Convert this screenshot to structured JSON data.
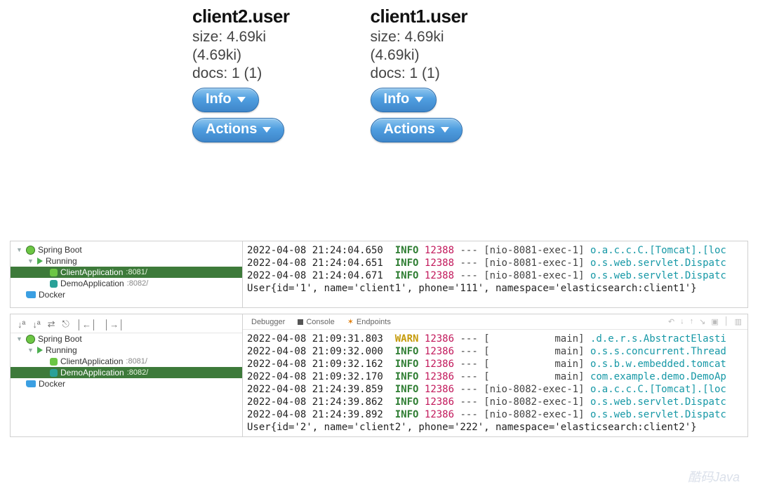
{
  "cards": [
    {
      "title": "client2.user",
      "size": "size: 4.69ki",
      "paren": "(4.69ki)",
      "docs": "docs: 1 (1)",
      "info": "Info",
      "actions": "Actions"
    },
    {
      "title": "client1.user",
      "size": "size: 4.69ki",
      "paren": "(4.69ki)",
      "docs": "docs: 1 (1)",
      "info": "Info",
      "actions": "Actions"
    }
  ],
  "tree1": {
    "springBoot": "Spring Boot",
    "running": "Running",
    "clientApp": "ClientApplication",
    "clientPort": ":8081/",
    "demoApp": "DemoApplication",
    "demoPort": ":8082/",
    "docker": "Docker"
  },
  "tree2": {
    "springBoot": "Spring Boot",
    "running": "Running",
    "clientApp": "ClientApplication",
    "clientPort": ":8081/",
    "demoApp": "DemoApplication",
    "demoPort": ":8082/",
    "docker": "Docker"
  },
  "toolbar2": {
    "t1": "↓ª",
    "t2": "↓ª",
    "t3": "⇄",
    "t4": "⎋",
    "t5": "│←│",
    "t6": "│→│"
  },
  "tabs": {
    "debugger": "Debugger",
    "console": "Console",
    "endpoints": "Endpoints"
  },
  "logs1": [
    {
      "ts": "2022-04-08 21:24:04.650",
      "lvl": "INFO",
      "pid": "12388",
      "thr": "[nio-8081-exec-1]",
      "cls": "o.a.c.c.C.[Tomcat].[loc"
    },
    {
      "ts": "2022-04-08 21:24:04.651",
      "lvl": "INFO",
      "pid": "12388",
      "thr": "[nio-8081-exec-1]",
      "cls": "o.s.web.servlet.Dispatc"
    },
    {
      "ts": "2022-04-08 21:24:04.671",
      "lvl": "INFO",
      "pid": "12388",
      "thr": "[nio-8081-exec-1]",
      "cls": "o.s.web.servlet.Dispatc"
    }
  ],
  "out1": "User{id='1', name='client1', phone='111', namespace='elasticsearch:client1'}",
  "logs2": [
    {
      "ts": "2022-04-08 21:09:31.803",
      "lvl": "WARN",
      "pid": "12386",
      "thr": "[           main]",
      "cls": ".d.e.r.s.AbstractElasti"
    },
    {
      "ts": "2022-04-08 21:09:32.000",
      "lvl": "INFO",
      "pid": "12386",
      "thr": "[           main]",
      "cls": "o.s.s.concurrent.Thread"
    },
    {
      "ts": "2022-04-08 21:09:32.162",
      "lvl": "INFO",
      "pid": "12386",
      "thr": "[           main]",
      "cls": "o.s.b.w.embedded.tomcat"
    },
    {
      "ts": "2022-04-08 21:09:32.170",
      "lvl": "INFO",
      "pid": "12386",
      "thr": "[           main]",
      "cls": "com.example.demo.DemoAp"
    },
    {
      "ts": "2022-04-08 21:24:39.859",
      "lvl": "INFO",
      "pid": "12386",
      "thr": "[nio-8082-exec-1]",
      "cls": "o.a.c.c.C.[Tomcat].[loc"
    },
    {
      "ts": "2022-04-08 21:24:39.862",
      "lvl": "INFO",
      "pid": "12386",
      "thr": "[nio-8082-exec-1]",
      "cls": "o.s.web.servlet.Dispatc"
    },
    {
      "ts": "2022-04-08 21:24:39.892",
      "lvl": "INFO",
      "pid": "12386",
      "thr": "[nio-8082-exec-1]",
      "cls": "o.s.web.servlet.Dispatc"
    }
  ],
  "out2": "User{id='2', name='client2', phone='222', namespace='elasticsearch:client2'}",
  "watermark": "酷码Java"
}
